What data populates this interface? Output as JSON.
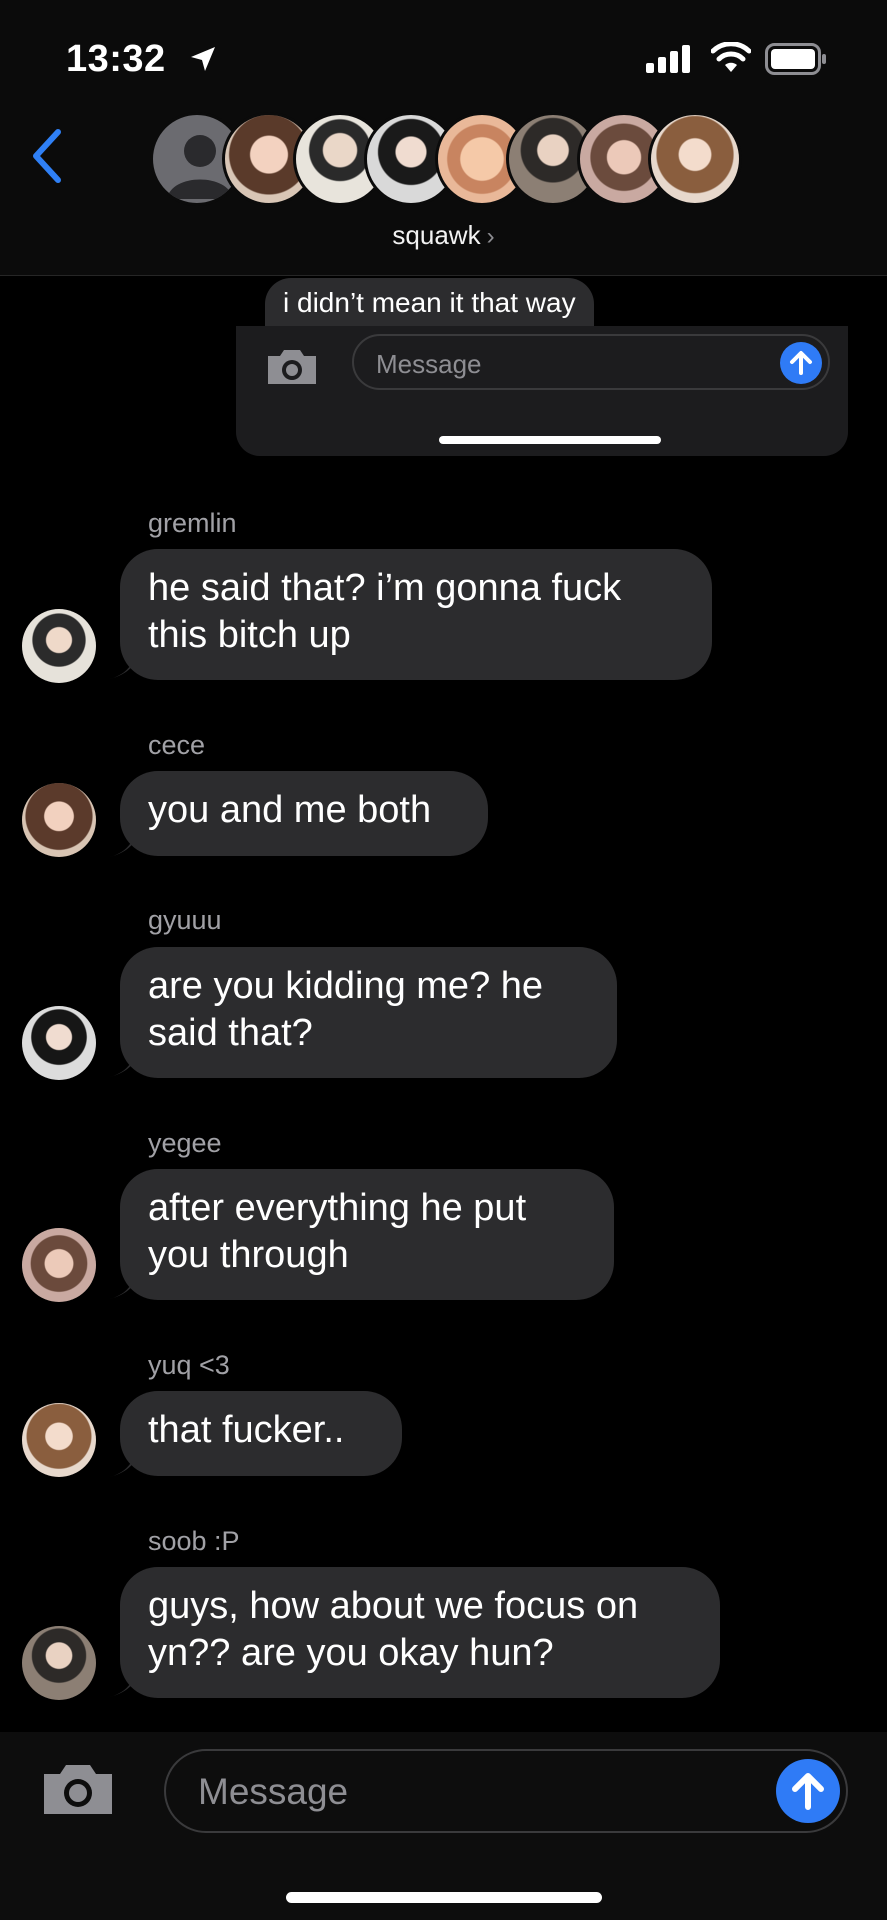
{
  "status_bar": {
    "time": "13:32"
  },
  "header": {
    "group_name": "squawk",
    "chevron": "›"
  },
  "preview": {
    "bubble_text": "i didn’t mean it that way",
    "message_placeholder": "Message"
  },
  "messages": [
    {
      "sender": "gremlin",
      "lines": [
        "he said that? i’m gonna fuck",
        "this bitch up"
      ]
    },
    {
      "sender": "cece",
      "lines": [
        "you and me both"
      ]
    },
    {
      "sender": "gyuuu",
      "lines": [
        "are you kidding me? he",
        "said that?"
      ]
    },
    {
      "sender": "yegee",
      "lines": [
        "after everything he put",
        "you through"
      ]
    },
    {
      "sender": "yuq <3",
      "lines": [
        "that fucker.."
      ]
    },
    {
      "sender": "soob :P",
      "lines": [
        "guys, how about we focus on",
        "yn?? are you okay hun?"
      ]
    }
  ],
  "compose": {
    "placeholder": "Message"
  },
  "colors": {
    "accent": "#2f7bf6",
    "bubble": "#2c2c2e",
    "background": "#000000"
  }
}
